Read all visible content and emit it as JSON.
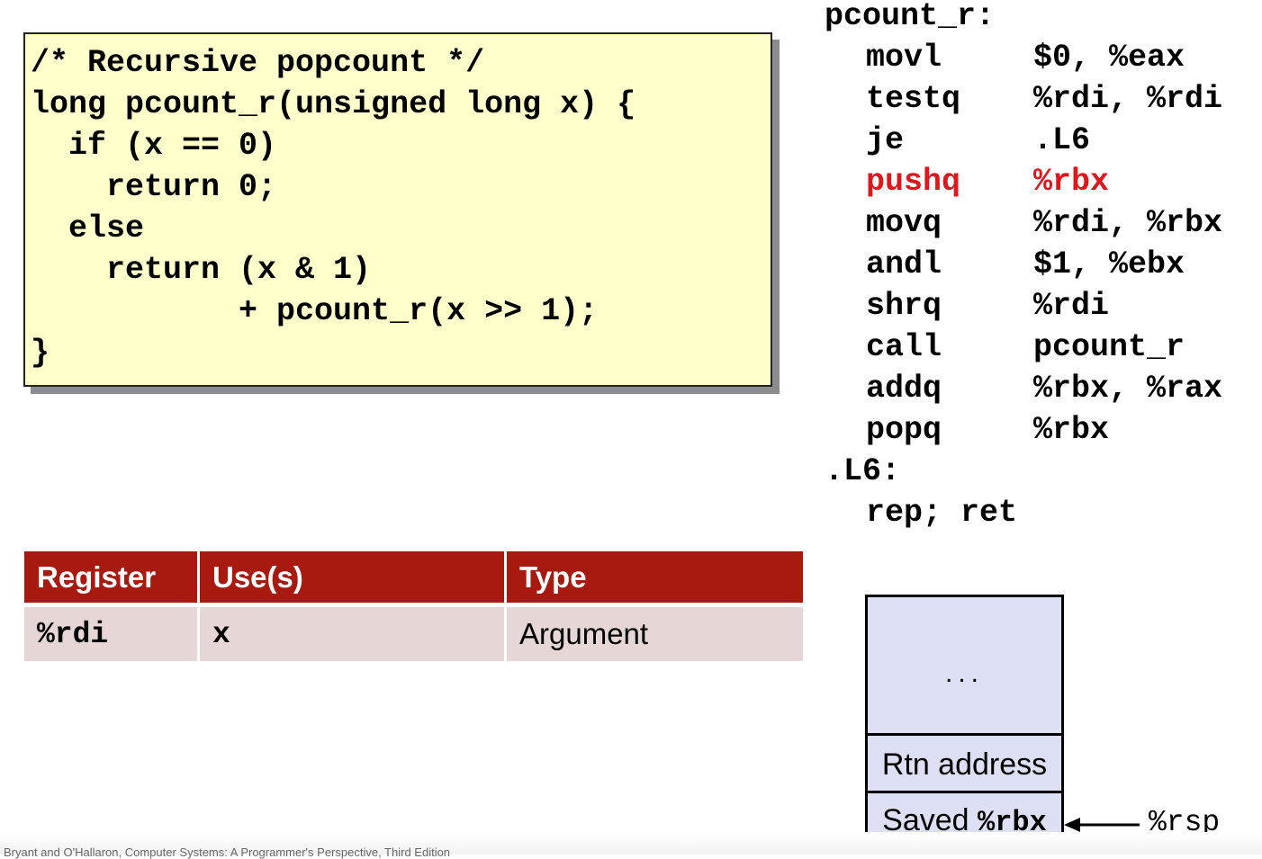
{
  "code": {
    "lines": [
      "/* Recursive popcount */",
      "long pcount_r(unsigned long x) {",
      "  if (x == 0)",
      "    return 0;",
      "  else",
      "    return (x & 1)",
      "           + pcount_r(x >> 1);",
      "}"
    ]
  },
  "assembly": {
    "label_func": "pcount_r:",
    "instructions": [
      {
        "op": "movl",
        "args": "$0, %eax"
      },
      {
        "op": "testq",
        "args": "%rdi, %rdi"
      },
      {
        "op": "je",
        "args": ".L6"
      },
      {
        "op": "pushq",
        "args": "%rbx",
        "highlight": true
      },
      {
        "op": "movq",
        "args": "%rdi, %rbx"
      },
      {
        "op": "andl",
        "args": "$1, %ebx"
      },
      {
        "op": "shrq",
        "args": "%rdi"
      },
      {
        "op": "call",
        "args": "pcount_r"
      },
      {
        "op": "addq",
        "args": "%rbx, %rax"
      },
      {
        "op": "popq",
        "args": "%rbx"
      }
    ],
    "label_l6": ".L6:",
    "final": "rep; ret",
    "highlight_color": "#e0161c"
  },
  "register_table": {
    "headers": [
      "Register",
      "Use(s)",
      "Type"
    ],
    "row": {
      "register": "%rdi",
      "use": "x",
      "type": "Argument"
    },
    "header_color": "#a8190f",
    "row_color": "#e6d6d6"
  },
  "stack": {
    "dots": "...",
    "rtn": "Rtn address",
    "saved_prefix": "Saved ",
    "saved_reg": "%rbx",
    "pointer": "%rsp",
    "fill_color": "#dde0f4"
  },
  "footer": {
    "text": "Bryant and O'Hallaron, Computer Systems: A Programmer's Perspective, Third Edition"
  }
}
